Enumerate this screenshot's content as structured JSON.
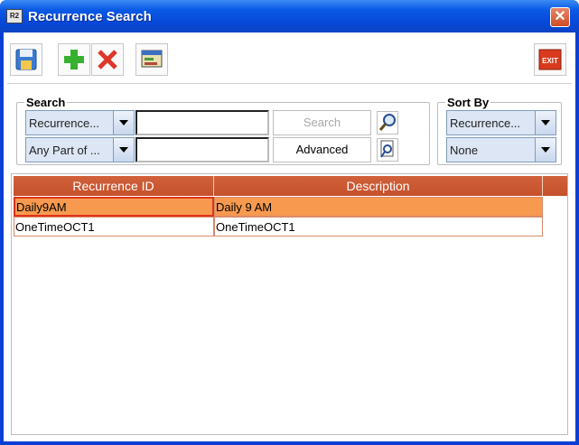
{
  "window": {
    "title": "Recurrence Search",
    "app_icon_text": "R2",
    "close_glyph": "✕"
  },
  "toolbar": {
    "buttons": [
      {
        "name": "save-icon"
      },
      {
        "name": "add-icon"
      },
      {
        "name": "delete-icon"
      },
      {
        "name": "view-icon"
      },
      {
        "name": "exit-icon",
        "label": "EXIT"
      }
    ]
  },
  "search": {
    "label": "Search",
    "field_combo": "Recurrence...",
    "match_combo": "Any Part of ...",
    "field_value": "",
    "match_value": "",
    "search_button": "Search",
    "advanced_button": "Advanced"
  },
  "sort": {
    "label": "Sort By",
    "primary": "Recurrence...",
    "secondary": "None"
  },
  "table": {
    "columns": [
      "Recurrence ID",
      "Description"
    ],
    "rows": [
      {
        "id": "Daily9AM",
        "description": "Daily 9 AM",
        "selected": true
      },
      {
        "id": "OneTimeOCT1",
        "description": "OneTimeOCT1",
        "selected": false
      }
    ]
  },
  "colors": {
    "title_bar": "#0a5ae6",
    "header": "#c8552e",
    "selection": "#f79a4f"
  }
}
